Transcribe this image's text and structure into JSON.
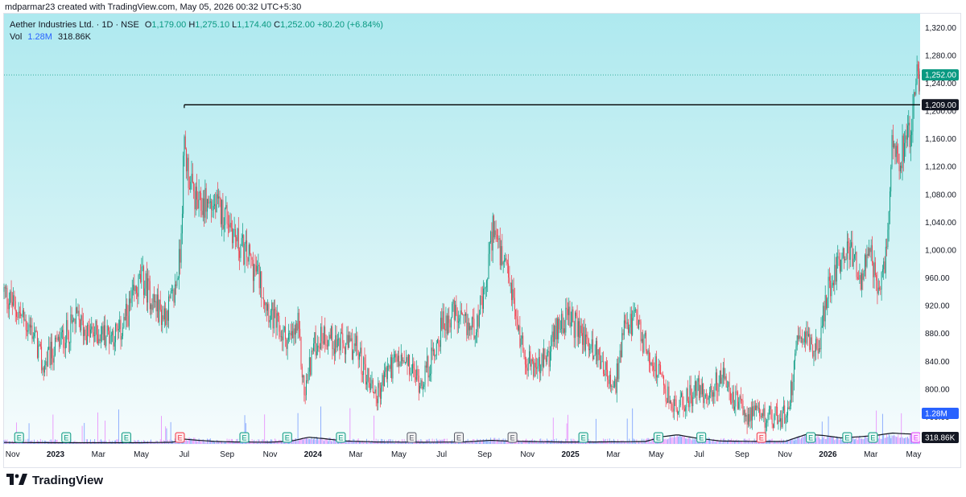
{
  "header": {
    "credit": "mdparmar23 created with TradingView.com, May 05, 2026 00:32 UTC+5:30"
  },
  "legend": {
    "title": "Aether Industries Ltd. · 1D · NSE",
    "open_label": "O",
    "open": "1,179.00",
    "high_label": "H",
    "high": "1,275.10",
    "low_label": "L",
    "low": "1,174.40",
    "close_label": "C",
    "close": "1,252.00",
    "change": "+80.20 (+6.84%)",
    "vol_label": "Vol",
    "vol": "1.28M",
    "vol_ma": "318.86K"
  },
  "brand": {
    "name": "TradingView"
  },
  "colors": {
    "up": "#089981",
    "down": "#f23645",
    "vol_up": "#2962ff",
    "vol_down": "#e040fb",
    "level": "#000000",
    "last_price": "#089981"
  },
  "chart_data": {
    "type": "candlestick",
    "symbol": "Aether Industries Ltd.",
    "interval": "1D",
    "exchange": "NSE",
    "ylim": [
      720,
      1340
    ],
    "y_ticks": [
      "1,320.00",
      "1,280.00",
      "1,240.00",
      "1,200.00",
      "1,160.00",
      "1,120.00",
      "1,080.00",
      "1,040.00",
      "1,000.00",
      "960.00",
      "920.00",
      "880.00",
      "840.00",
      "800.00",
      "760.00"
    ],
    "y_tick_values": [
      1320,
      1280,
      1240,
      1200,
      1160,
      1120,
      1080,
      1040,
      1000,
      960,
      920,
      880,
      840,
      800,
      760
    ],
    "x_ticks": [
      {
        "label": "Nov",
        "t": 0.0
      },
      {
        "label": "2023",
        "t": 2.0
      },
      {
        "label": "Mar",
        "t": 4.0
      },
      {
        "label": "May",
        "t": 6.0
      },
      {
        "label": "Jul",
        "t": 8.0
      },
      {
        "label": "Sep",
        "t": 10.0
      },
      {
        "label": "Nov",
        "t": 12.0
      },
      {
        "label": "2024",
        "t": 14.0
      },
      {
        "label": "Mar",
        "t": 16.0
      },
      {
        "label": "May",
        "t": 18.0
      },
      {
        "label": "Jul",
        "t": 20.0
      },
      {
        "label": "Sep",
        "t": 22.0
      },
      {
        "label": "Nov",
        "t": 24.0
      },
      {
        "label": "2025",
        "t": 26.0
      },
      {
        "label": "Mar",
        "t": 28.0
      },
      {
        "label": "May",
        "t": 30.0
      },
      {
        "label": "Jul",
        "t": 32.0
      },
      {
        "label": "Sep",
        "t": 34.0
      },
      {
        "label": "Nov",
        "t": 36.0
      },
      {
        "label": "2026",
        "t": 38.0
      },
      {
        "label": "Mar",
        "t": 40.0
      },
      {
        "label": "May",
        "t": 42.0
      }
    ],
    "t_range": [
      -0.4,
      42.3
    ],
    "price_path": [
      [
        -0.4,
        940
      ],
      [
        0.5,
        900
      ],
      [
        1.0,
        880
      ],
      [
        1.4,
        830
      ],
      [
        2.0,
        860
      ],
      [
        2.5,
        880
      ],
      [
        3.0,
        900
      ],
      [
        3.5,
        880
      ],
      [
        4.0,
        880
      ],
      [
        4.5,
        880
      ],
      [
        5.0,
        880
      ],
      [
        5.5,
        920
      ],
      [
        6.0,
        960
      ],
      [
        6.5,
        930
      ],
      [
        7.0,
        905
      ],
      [
        7.5,
        930
      ],
      [
        7.8,
        990
      ],
      [
        8.0,
        1150
      ],
      [
        8.3,
        1090
      ],
      [
        8.7,
        1060
      ],
      [
        9.0,
        1070
      ],
      [
        9.5,
        1060
      ],
      [
        10.0,
        1050
      ],
      [
        10.5,
        1010
      ],
      [
        11.0,
        990
      ],
      [
        11.5,
        960
      ],
      [
        12.0,
        910
      ],
      [
        12.5,
        880
      ],
      [
        13.0,
        870
      ],
      [
        13.3,
        890
      ],
      [
        13.6,
        790
      ],
      [
        14.0,
        860
      ],
      [
        14.5,
        880
      ],
      [
        15.0,
        870
      ],
      [
        15.5,
        860
      ],
      [
        16.0,
        860
      ],
      [
        16.5,
        820
      ],
      [
        17.0,
        790
      ],
      [
        17.5,
        830
      ],
      [
        18.0,
        840
      ],
      [
        18.5,
        830
      ],
      [
        19.0,
        810
      ],
      [
        19.5,
        840
      ],
      [
        20.0,
        890
      ],
      [
        20.5,
        910
      ],
      [
        21.0,
        890
      ],
      [
        21.5,
        890
      ],
      [
        22.0,
        930
      ],
      [
        22.4,
        1040
      ],
      [
        22.8,
        980
      ],
      [
        23.2,
        950
      ],
      [
        23.6,
        880
      ],
      [
        24.0,
        840
      ],
      [
        24.5,
        830
      ],
      [
        25.0,
        850
      ],
      [
        25.5,
        900
      ],
      [
        26.0,
        900
      ],
      [
        26.5,
        880
      ],
      [
        27.0,
        860
      ],
      [
        27.5,
        840
      ],
      [
        28.0,
        790
      ],
      [
        28.5,
        880
      ],
      [
        29.0,
        900
      ],
      [
        29.5,
        860
      ],
      [
        30.0,
        830
      ],
      [
        30.5,
        790
      ],
      [
        31.0,
        770
      ],
      [
        31.5,
        790
      ],
      [
        32.0,
        800
      ],
      [
        32.5,
        790
      ],
      [
        33.0,
        820
      ],
      [
        33.5,
        790
      ],
      [
        34.0,
        770
      ],
      [
        34.5,
        760
      ],
      [
        35.0,
        760
      ],
      [
        35.5,
        760
      ],
      [
        36.0,
        760
      ],
      [
        36.3,
        800
      ],
      [
        36.6,
        890
      ],
      [
        37.0,
        880
      ],
      [
        37.5,
        850
      ],
      [
        38.0,
        940
      ],
      [
        38.5,
        990
      ],
      [
        39.0,
        1000
      ],
      [
        39.5,
        960
      ],
      [
        40.0,
        990
      ],
      [
        40.4,
        930
      ],
      [
        40.8,
        1020
      ],
      [
        41.0,
        1180
      ],
      [
        41.3,
        1130
      ],
      [
        41.6,
        1160
      ],
      [
        41.9,
        1180
      ],
      [
        42.2,
        1252
      ]
    ],
    "horizontal_level": {
      "value": 1209,
      "label": "1,209.00",
      "from_t": 8.0
    },
    "last_price": {
      "value": 1252,
      "label": "1,252.00"
    },
    "volume_labels": {
      "last": "1.28M",
      "ma": "318.86K"
    },
    "volume_ma_path": [
      [
        -0.4,
        0.06
      ],
      [
        2.0,
        0.05
      ],
      [
        4.0,
        0.05
      ],
      [
        6.0,
        0.05
      ],
      [
        7.5,
        0.07
      ],
      [
        8.0,
        0.2
      ],
      [
        8.5,
        0.16
      ],
      [
        9.5,
        0.1
      ],
      [
        10.5,
        0.08
      ],
      [
        12.0,
        0.07
      ],
      [
        13.0,
        0.12
      ],
      [
        13.8,
        0.28
      ],
      [
        14.5,
        0.22
      ],
      [
        15.5,
        0.12
      ],
      [
        17.0,
        0.08
      ],
      [
        19.0,
        0.07
      ],
      [
        21.0,
        0.08
      ],
      [
        22.3,
        0.15
      ],
      [
        23.0,
        0.12
      ],
      [
        24.0,
        0.1
      ],
      [
        25.5,
        0.08
      ],
      [
        27.0,
        0.08
      ],
      [
        28.5,
        0.09
      ],
      [
        29.5,
        0.1
      ],
      [
        30.3,
        0.3
      ],
      [
        31.0,
        0.38
      ],
      [
        31.8,
        0.25
      ],
      [
        33.0,
        0.12
      ],
      [
        35.0,
        0.1
      ],
      [
        36.0,
        0.1
      ],
      [
        36.4,
        0.22
      ],
      [
        37.0,
        0.4
      ],
      [
        37.8,
        0.35
      ],
      [
        38.6,
        0.25
      ],
      [
        39.5,
        0.3
      ],
      [
        40.2,
        0.35
      ],
      [
        41.0,
        0.45
      ],
      [
        41.6,
        0.42
      ],
      [
        42.2,
        0.4
      ]
    ],
    "earnings_markers": [
      {
        "label": "E",
        "t": 0.3,
        "kind": "green"
      },
      {
        "label": "E",
        "t": 2.5,
        "kind": "green"
      },
      {
        "label": "E",
        "t": 5.3,
        "kind": "green"
      },
      {
        "label": "E",
        "t": 7.8,
        "kind": "red"
      },
      {
        "label": "E",
        "t": 10.8,
        "kind": "green"
      },
      {
        "label": "E",
        "t": 12.8,
        "kind": "green"
      },
      {
        "label": "E",
        "t": 15.3,
        "kind": "green"
      },
      {
        "label": "E",
        "t": 18.6,
        "kind": "gray"
      },
      {
        "label": "E",
        "t": 20.8,
        "kind": "gray"
      },
      {
        "label": "E",
        "t": 23.3,
        "kind": "gray"
      },
      {
        "label": "E",
        "t": 26.6,
        "kind": "green"
      },
      {
        "label": "E",
        "t": 30.1,
        "kind": "green"
      },
      {
        "label": "E",
        "t": 32.1,
        "kind": "green"
      },
      {
        "label": "E",
        "t": 34.9,
        "kind": "red"
      },
      {
        "label": "E",
        "t": 37.2,
        "kind": "green"
      },
      {
        "label": "E",
        "t": 38.9,
        "kind": "green"
      },
      {
        "label": "E",
        "t": 40.1,
        "kind": "green"
      },
      {
        "label": "E",
        "t": 42.1,
        "kind": "pink"
      }
    ],
    "grid": false,
    "legend_position": "top-left"
  }
}
